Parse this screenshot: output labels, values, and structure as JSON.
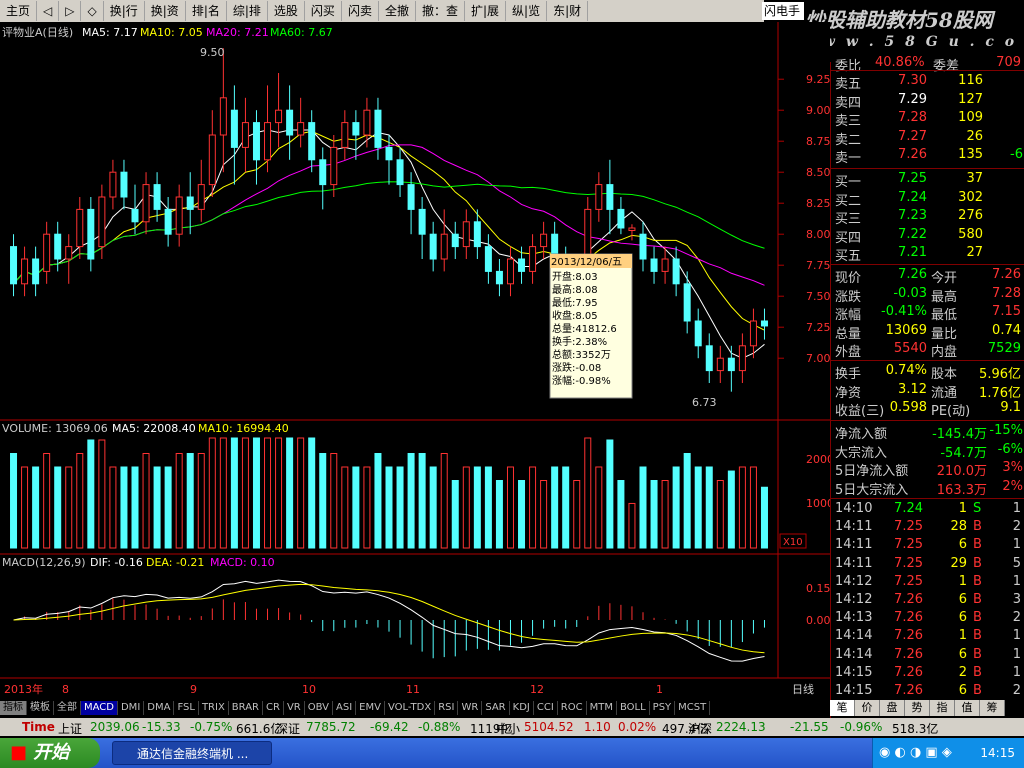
{
  "menu": [
    "主页",
    "◁",
    "▷",
    "◇",
    "换|行",
    "换|资",
    "排|名",
    "综|排",
    "选股",
    "闪买",
    "闪卖",
    "全撤",
    "撤：查",
    "扩|展",
    "纵|览",
    "东|财"
  ],
  "tab_flash": "闪电手",
  "logo": {
    "text": "炒股辅助教材58股网",
    "url": "w w w . 5 8 G u . c o m"
  },
  "main_header": {
    "name": "评物业A(日线)",
    "ma5": "MA5: 7.17",
    "ma10": "MA10: 7.05",
    "ma20": "MA20: 7.21",
    "ma60": "MA60: 7.67"
  },
  "vol_header": {
    "name": "VOLUME: 13069.06",
    "ma5": "MA5: 22008.40",
    "ma10": "MA10: 16994.40"
  },
  "macd_header": {
    "name": "MACD(12,26,9)",
    "dif": "DIF: -0.16",
    "dea": "DEA: -0.21",
    "macd": "MACD: 0.10"
  },
  "price_axis": [
    "9.25",
    "9.00",
    "8.75",
    "8.50",
    "8.25",
    "8.00",
    "7.75",
    "7.50",
    "7.25",
    "7.00"
  ],
  "vol_axis": [
    "20000",
    "10000"
  ],
  "vol_unit": "X10",
  "macd_axis": [
    "0.15",
    "0.00"
  ],
  "annotations": {
    "high": "9.50",
    "low": "6.73"
  },
  "time_axis": [
    "2013年",
    "8",
    "9",
    "10",
    "11",
    "12",
    "1"
  ],
  "period_label": "日线",
  "popup": {
    "date": "2013/12/06/五",
    "lines": [
      "开盘:8.03",
      "最高:8.08",
      "最低:7.95",
      "收盘:8.05",
      "总量:41812.6",
      "换手:2.38%",
      "总额:3352万",
      "涨跌:-0.08",
      "涨幅:-0.98%"
    ]
  },
  "quote": {
    "top_partial": {
      "l1": "委比",
      "v1": "40.86%",
      "l2": "委差",
      "v2": "709"
    },
    "asks": [
      {
        "label": "卖五",
        "price": "7.30",
        "vol": "116",
        "chg": ""
      },
      {
        "label": "卖四",
        "price": "7.29",
        "vol": "127",
        "chg": ""
      },
      {
        "label": "卖三",
        "price": "7.28",
        "vol": "109",
        "chg": ""
      },
      {
        "label": "卖二",
        "price": "7.27",
        "vol": "26",
        "chg": ""
      },
      {
        "label": "卖一",
        "price": "7.26",
        "vol": "135",
        "chg": "-6"
      }
    ],
    "bids": [
      {
        "label": "买一",
        "price": "7.25",
        "vol": "37"
      },
      {
        "label": "买二",
        "price": "7.24",
        "vol": "302"
      },
      {
        "label": "买三",
        "price": "7.23",
        "vol": "276"
      },
      {
        "label": "买四",
        "price": "7.22",
        "vol": "580"
      },
      {
        "label": "买五",
        "price": "7.21",
        "vol": "27"
      }
    ],
    "stats": [
      {
        "l1": "现价",
        "v1": "7.26",
        "l2": "今开",
        "v2": "7.26"
      },
      {
        "l1": "涨跌",
        "v1": "-0.03",
        "l2": "最高",
        "v2": "7.28"
      },
      {
        "l1": "涨幅",
        "v1": "-0.41%",
        "l2": "最低",
        "v2": "7.15"
      },
      {
        "l1": "总量",
        "v1": "13069",
        "l2": "量比",
        "v2": "0.74"
      },
      {
        "l1": "外盘",
        "v1": "5540",
        "l2": "内盘",
        "v2": "7529"
      }
    ],
    "stats2": [
      {
        "l1": "换手",
        "v1": "0.74%",
        "l2": "股本",
        "v2": "5.96亿"
      },
      {
        "l1": "净资",
        "v1": "3.12",
        "l2": "流通",
        "v2": "1.76亿"
      },
      {
        "l1": "收益(三)",
        "v1": "0.598",
        "l2": "PE(动)",
        "v2": "9.1"
      }
    ],
    "flows": [
      {
        "label": "净流入额",
        "value": "-145.4万",
        "pct": "-15%"
      },
      {
        "label": "大宗流入",
        "value": "-54.7万",
        "pct": "-6%"
      },
      {
        "label": "5日净流入额",
        "value": "210.0万",
        "pct": "3%"
      },
      {
        "label": "5日大宗流入",
        "value": "163.3万",
        "pct": "2%"
      }
    ],
    "ticks": [
      {
        "t": "14:10",
        "p": "7.24",
        "v": "1",
        "f": "S",
        "n": "1"
      },
      {
        "t": "14:11",
        "p": "7.25",
        "v": "28",
        "f": "B",
        "n": "2"
      },
      {
        "t": "14:11",
        "p": "7.25",
        "v": "6",
        "f": "B",
        "n": "1"
      },
      {
        "t": "14:11",
        "p": "7.25",
        "v": "29",
        "f": "B",
        "n": "5"
      },
      {
        "t": "14:12",
        "p": "7.25",
        "v": "1",
        "f": "B",
        "n": "1"
      },
      {
        "t": "14:12",
        "p": "7.26",
        "v": "6",
        "f": "B",
        "n": "3"
      },
      {
        "t": "14:13",
        "p": "7.26",
        "v": "6",
        "f": "B",
        "n": "2"
      },
      {
        "t": "14:14",
        "p": "7.26",
        "v": "1",
        "f": "B",
        "n": "1"
      },
      {
        "t": "14:14",
        "p": "7.26",
        "v": "6",
        "f": "B",
        "n": "1"
      },
      {
        "t": "14:15",
        "p": "7.26",
        "v": "2",
        "f": "B",
        "n": "1"
      },
      {
        "t": "14:15",
        "p": "7.26",
        "v": "6",
        "f": "B",
        "n": "2"
      }
    ]
  },
  "indicators": [
    "指标",
    "模板",
    "全部",
    "MACD",
    "DMI",
    "DMA",
    "FSL",
    "TRIX",
    "BRAR",
    "CR",
    "VR",
    "OBV",
    "ASI",
    "EMV",
    "VOL-TDX",
    "RSI",
    "WR",
    "SAR",
    "KDJ",
    "CCI",
    "ROC",
    "MTM",
    "BOLL",
    "PSY",
    "MCST"
  ],
  "right_tabs": [
    "笔",
    "价",
    "盘",
    "势",
    "指",
    "值",
    "筹"
  ],
  "ticker": [
    {
      "name": "Time",
      "val": "",
      "c1": "",
      "c2": "",
      "amt": ""
    },
    {
      "name": "上证",
      "val": "2039.06",
      "c1": "-15.33",
      "c2": "-0.75%",
      "amt": "661.6亿"
    },
    {
      "name": "深证",
      "val": "7785.72",
      "c1": "-69.42",
      "c2": "-0.88%",
      "amt": "1119亿"
    },
    {
      "name": "中小",
      "val": "5104.52",
      "c1": "1.10",
      "c2": "0.02%",
      "amt": "497.4亿"
    },
    {
      "name": "沪深",
      "val": "2224.13",
      "c1": "-21.55",
      "c2": "-0.96%",
      "amt": "518.3亿"
    }
  ],
  "taskbar": {
    "start": "开始",
    "task": "通达信金融终端机 ...",
    "clock": "14:15"
  },
  "colors": {
    "up": "#ff3232",
    "down": "#54ffff",
    "ma5": "#ffffff",
    "ma10": "#ffff00",
    "ma20": "#ff00ff",
    "ma60": "#00ff00"
  },
  "chart_data": {
    "type": "candlestick",
    "ylim": [
      6.7,
      9.5
    ],
    "candles": [
      [
        7.9,
        7.6,
        8.0,
        7.5
      ],
      [
        7.6,
        7.8,
        7.9,
        7.5
      ],
      [
        7.8,
        7.6,
        7.9,
        7.5
      ],
      [
        7.7,
        8.0,
        8.1,
        7.6
      ],
      [
        8.0,
        7.8,
        8.1,
        7.7
      ],
      [
        7.8,
        7.9,
        8.0,
        7.6
      ],
      [
        7.9,
        8.2,
        8.3,
        7.8
      ],
      [
        8.2,
        7.8,
        8.3,
        7.7
      ],
      [
        7.9,
        8.3,
        8.4,
        7.8
      ],
      [
        8.3,
        8.5,
        8.6,
        8.2
      ],
      [
        8.5,
        8.3,
        8.6,
        8.2
      ],
      [
        8.2,
        8.1,
        8.4,
        8.0
      ],
      [
        8.1,
        8.4,
        8.5,
        8.0
      ],
      [
        8.4,
        8.2,
        8.5,
        8.1
      ],
      [
        8.2,
        8.0,
        8.3,
        7.9
      ],
      [
        8.0,
        8.3,
        8.4,
        7.9
      ],
      [
        8.3,
        8.2,
        8.5,
        8.0
      ],
      [
        8.2,
        8.4,
        8.6,
        8.1
      ],
      [
        8.4,
        8.8,
        9.0,
        8.3
      ],
      [
        8.8,
        9.1,
        9.5,
        8.5
      ],
      [
        9.0,
        8.7,
        9.2,
        8.4
      ],
      [
        8.7,
        8.9,
        9.1,
        8.5
      ],
      [
        8.9,
        8.6,
        9.0,
        8.4
      ],
      [
        8.6,
        8.9,
        9.2,
        8.5
      ],
      [
        8.9,
        9.0,
        9.3,
        8.7
      ],
      [
        9.0,
        8.8,
        9.2,
        8.6
      ],
      [
        8.8,
        8.9,
        9.1,
        8.7
      ],
      [
        8.9,
        8.6,
        9.0,
        8.5
      ],
      [
        8.6,
        8.4,
        8.7,
        8.2
      ],
      [
        8.4,
        8.7,
        8.8,
        8.3
      ],
      [
        8.7,
        8.9,
        9.0,
        8.6
      ],
      [
        8.9,
        8.8,
        9.0,
        8.6
      ],
      [
        8.8,
        9.0,
        9.1,
        8.7
      ],
      [
        9.0,
        8.7,
        9.1,
        8.6
      ],
      [
        8.7,
        8.6,
        8.8,
        8.4
      ],
      [
        8.6,
        8.4,
        8.7,
        8.3
      ],
      [
        8.4,
        8.2,
        8.5,
        8.0
      ],
      [
        8.2,
        8.0,
        8.3,
        7.8
      ],
      [
        8.0,
        7.8,
        8.1,
        7.7
      ],
      [
        7.8,
        8.0,
        8.2,
        7.7
      ],
      [
        8.0,
        7.9,
        8.1,
        7.8
      ],
      [
        7.9,
        8.1,
        8.2,
        7.8
      ],
      [
        8.1,
        7.9,
        8.2,
        7.8
      ],
      [
        7.9,
        7.7,
        8.0,
        7.6
      ],
      [
        7.7,
        7.6,
        7.8,
        7.5
      ],
      [
        7.6,
        7.8,
        7.9,
        7.5
      ],
      [
        7.8,
        7.7,
        7.9,
        7.6
      ],
      [
        7.7,
        7.9,
        8.0,
        7.6
      ],
      [
        7.9,
        8.0,
        8.1,
        7.8
      ],
      [
        8.0,
        7.8,
        8.1,
        7.7
      ],
      [
        7.8,
        7.6,
        7.9,
        7.5
      ],
      [
        7.6,
        7.7,
        7.8,
        7.5
      ],
      [
        7.7,
        8.2,
        8.3,
        7.6
      ],
      [
        8.2,
        8.4,
        8.5,
        8.1
      ],
      [
        8.4,
        8.2,
        8.6,
        8.0
      ],
      [
        8.2,
        8.05,
        8.3,
        8.0
      ],
      [
        8.03,
        8.05,
        8.08,
        7.95
      ],
      [
        8.0,
        7.8,
        8.1,
        7.7
      ],
      [
        7.8,
        7.7,
        7.9,
        7.6
      ],
      [
        7.7,
        7.8,
        7.9,
        7.6
      ],
      [
        7.8,
        7.6,
        7.9,
        7.5
      ],
      [
        7.6,
        7.3,
        7.7,
        7.2
      ],
      [
        7.3,
        7.1,
        7.4,
        7.0
      ],
      [
        7.1,
        6.9,
        7.2,
        6.8
      ],
      [
        6.9,
        7.0,
        7.1,
        6.8
      ],
      [
        7.0,
        6.9,
        7.1,
        6.73
      ],
      [
        6.9,
        7.1,
        7.2,
        6.8
      ],
      [
        7.1,
        7.3,
        7.4,
        7.0
      ],
      [
        7.3,
        7.26,
        7.4,
        7.15
      ]
    ],
    "ma5_tail": "7.17"
  }
}
